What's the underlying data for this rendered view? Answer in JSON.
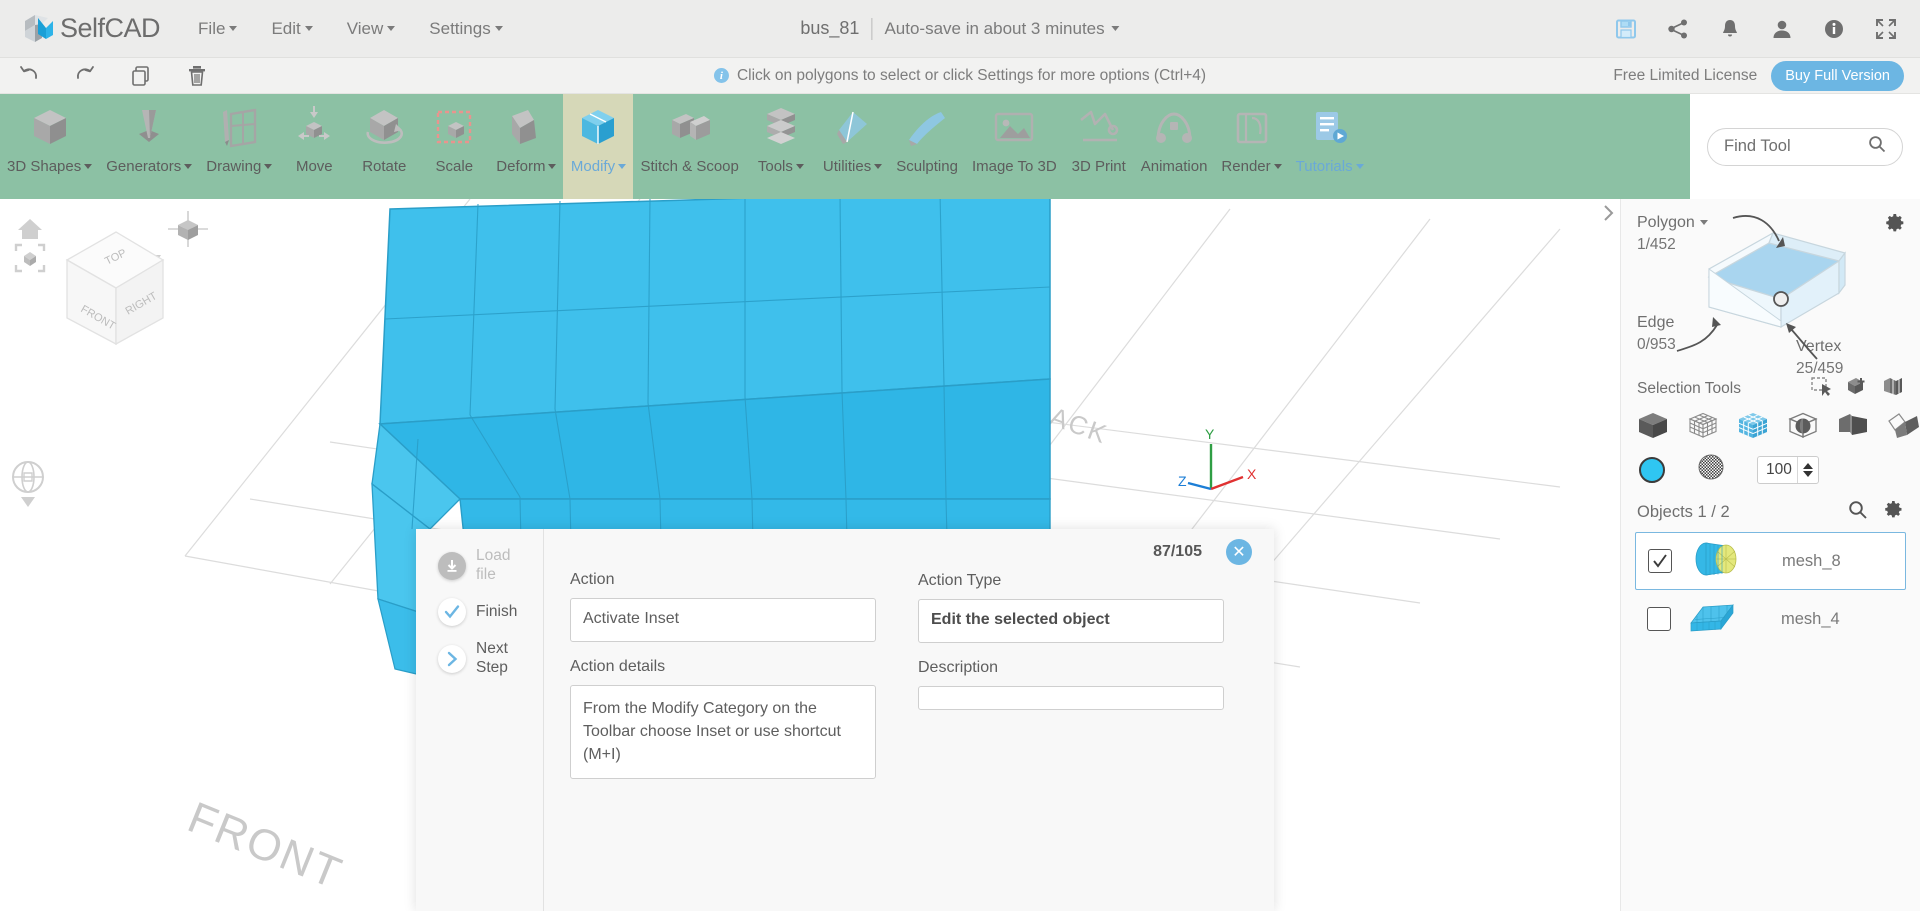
{
  "menubar": {
    "brand": "SelfCAD",
    "items": [
      {
        "label": "File"
      },
      {
        "label": "Edit"
      },
      {
        "label": "View"
      },
      {
        "label": "Settings"
      }
    ],
    "document_name": "bus_81",
    "autosave": "Auto-save in about 3 minutes",
    "icons": [
      {
        "name": "save-icon"
      },
      {
        "name": "share-icon"
      },
      {
        "name": "notifications-bell-icon"
      },
      {
        "name": "user-account-icon"
      },
      {
        "name": "info-icon"
      },
      {
        "name": "fullscreen-icon"
      }
    ]
  },
  "secondbar": {
    "icons": [
      {
        "name": "undo-icon"
      },
      {
        "name": "redo-icon"
      },
      {
        "name": "copy-icon"
      },
      {
        "name": "delete-trash-icon"
      }
    ],
    "hint": "Click on polygons to select or click Settings for more options (Ctrl+4)",
    "license": "Free Limited License",
    "buy_button": "Buy Full Version"
  },
  "toolbar": {
    "tools": [
      {
        "label": "3D Shapes",
        "icon": "cube-icon",
        "dropdown": true,
        "active": false
      },
      {
        "label": "Generators",
        "icon": "cone-drop-icon",
        "dropdown": true,
        "active": false
      },
      {
        "label": "Drawing",
        "icon": "pencil-sketch-icon",
        "dropdown": true,
        "active": false
      },
      {
        "label": "Move",
        "icon": "move-arrows-icon",
        "dropdown": false,
        "active": false
      },
      {
        "label": "Rotate",
        "icon": "rotate-cube-icon",
        "dropdown": false,
        "active": false
      },
      {
        "label": "Scale",
        "icon": "scale-cube-icon",
        "dropdown": false,
        "active": false
      },
      {
        "label": "Deform",
        "icon": "deform-cube-icon",
        "dropdown": true,
        "active": false
      },
      {
        "label": "Modify",
        "icon": "modify-cube-icon",
        "dropdown": true,
        "active": true
      },
      {
        "label": "Stitch & Scoop",
        "icon": "stitch-scoop-icon",
        "dropdown": false,
        "active": false
      },
      {
        "label": "Tools",
        "icon": "tools-layers-icon",
        "dropdown": true,
        "active": false
      },
      {
        "label": "Utilities",
        "icon": "utilities-icon",
        "dropdown": true,
        "active": false
      },
      {
        "label": "Sculpting",
        "icon": "sculpting-brush-icon",
        "dropdown": false,
        "active": false
      },
      {
        "label": "Image To 3D",
        "icon": "image-to-3d-icon",
        "dropdown": false,
        "active": false
      },
      {
        "label": "3D Print",
        "icon": "3d-print-icon",
        "dropdown": false,
        "active": false
      },
      {
        "label": "Animation",
        "icon": "animation-icon",
        "dropdown": false,
        "active": false
      },
      {
        "label": "Render",
        "icon": "render-icon",
        "dropdown": true,
        "active": false
      },
      {
        "label": "Tutorials",
        "icon": "tutorials-icon",
        "dropdown": true,
        "active": false
      }
    ],
    "find_tool": {
      "label": "Find Tool",
      "icon": "search-icon"
    }
  },
  "viewport": {
    "gizmos": [
      {
        "name": "home-view-icon"
      },
      {
        "name": "fit-to-view-icon"
      },
      {
        "name": "orbit-navigation-icon"
      },
      {
        "name": "axis-snap-icon"
      }
    ],
    "viewcube_faces": [
      "TOP",
      "FRONT",
      "RIGHT"
    ],
    "ground_labels": [
      "FRONT",
      "BACK"
    ],
    "axis_labels": [
      "X",
      "Y",
      "Z"
    ],
    "axis_colors": {
      "x": "#e03131",
      "y": "#2f9e44",
      "z": "#1c7ed6"
    },
    "model_color": "#29b6e8",
    "wheel_color": "#e8e87a",
    "panel_toggle_icon": "chevron-right-icon"
  },
  "rightpanel": {
    "settings_icon": "gear-icon",
    "selection_diagram": {
      "polygon": {
        "label": "Polygon",
        "count": "1/452",
        "dropdown": true
      },
      "edge": {
        "label": "Edge",
        "count": "0/953"
      },
      "vertex": {
        "label": "Vertex",
        "count": "25/459"
      }
    },
    "selection_tools": {
      "title": "Selection Tools",
      "top_icons": [
        {
          "name": "rectangle-select-icon"
        },
        {
          "name": "add-object-select-icon"
        },
        {
          "name": "multi-object-select-icon"
        }
      ],
      "mode_icons": [
        {
          "name": "solid-cube-mode-icon",
          "active": false
        },
        {
          "name": "wireframe-cube-mode-icon",
          "active": false
        },
        {
          "name": "subdivided-cube-mode-icon",
          "active": true
        },
        {
          "name": "sphere-in-cube-mode-icon",
          "active": false
        },
        {
          "name": "split-cube-mode-icon",
          "active": false
        },
        {
          "name": "unfold-face-mode-icon",
          "active": false
        }
      ],
      "color_swatch": "#2fc6f2",
      "texture_icon": "checker-sphere-icon",
      "value": "100"
    },
    "objects": {
      "title": "Objects 1 / 2",
      "search_icon": "search-icon",
      "settings_icon": "gear-icon",
      "items": [
        {
          "name": "mesh_8",
          "checked": true,
          "selected": true,
          "thumb": "wheel-cylinder-thumb"
        },
        {
          "name": "mesh_4",
          "checked": false,
          "selected": false,
          "thumb": "bus-body-thumb"
        }
      ]
    }
  },
  "tutorial": {
    "steps": [
      {
        "label": "Load file",
        "icon": "download-icon",
        "state": "disabled"
      },
      {
        "label": "Finish",
        "icon": "check-icon",
        "state": "done"
      },
      {
        "label": "Next Step",
        "icon": "chevron-right-icon",
        "state": "next"
      }
    ],
    "counter": "87/105",
    "close_icon": "close-icon",
    "fields": {
      "action_label": "Action",
      "action_value": "Activate Inset",
      "action_type_label": "Action Type",
      "action_type_value": "Edit the selected object",
      "action_details_label": "Action details",
      "action_details_value": "From the Modify Category on the Toolbar choose Inset or use shortcut (M+I)",
      "description_label": "Description",
      "description_value": ""
    }
  }
}
